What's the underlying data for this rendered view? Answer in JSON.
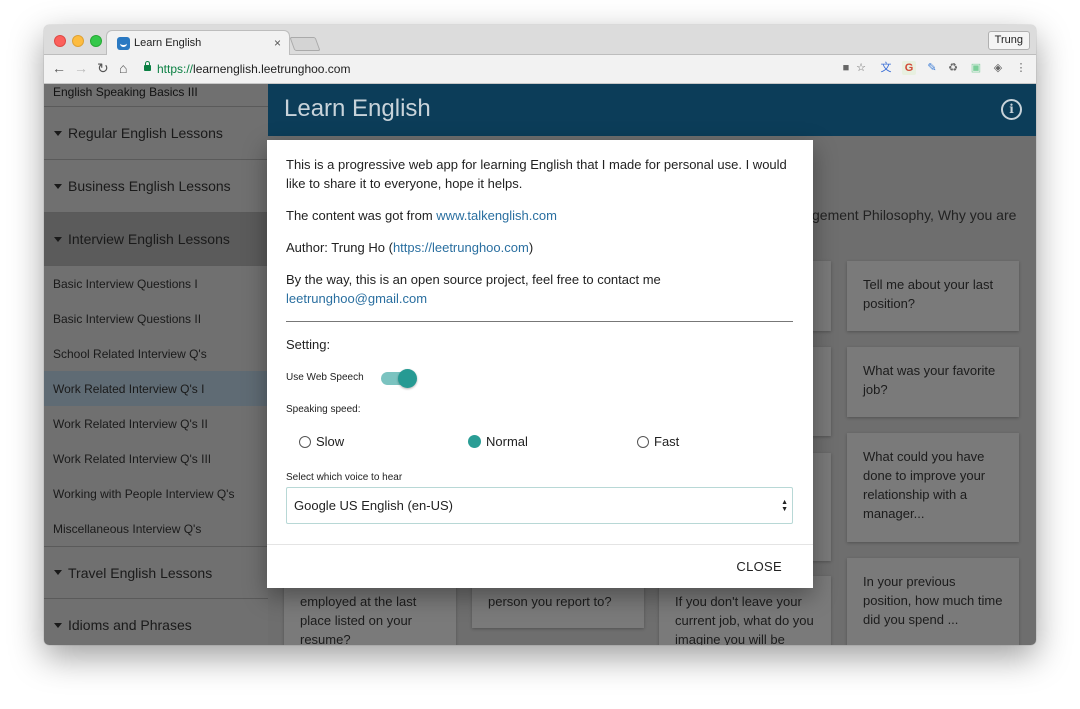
{
  "browser": {
    "tab_title": "Learn English",
    "tab_close": "×",
    "profile_name": "Trung",
    "url_scheme": "https://",
    "url_rest": "learnenglish.leetrunghoo.com",
    "nav": {
      "back": "←",
      "forward": "→",
      "reload": "↻",
      "home": "⌂"
    },
    "toolbar_icons": [
      "camera-icon",
      "star-icon",
      "translate-extension-icon",
      "google-extension-icon",
      "pen-extension-icon",
      "recycle-extension-icon",
      "extension-icon",
      "shield-extension-icon",
      "more-menu-icon"
    ],
    "toolbar_glyphs": [
      "■",
      "☆",
      "文",
      "G",
      "✎",
      "♻",
      "▣",
      "◈",
      "⋮"
    ]
  },
  "sidebar": {
    "top_item": "English Speaking Basics III",
    "sections_before": [
      {
        "label": "Regular English Lessons"
      },
      {
        "label": "Business English Lessons"
      }
    ],
    "open_section": {
      "label": "Interview English Lessons"
    },
    "items": [
      {
        "label": "Basic Interview Questions I"
      },
      {
        "label": "Basic Interview Questions II"
      },
      {
        "label": "School Related Interview Q's"
      },
      {
        "label": "Work Related Interview Q's I",
        "active": true
      },
      {
        "label": "Work Related Interview Q's II"
      },
      {
        "label": "Work Related Interview Q's III"
      },
      {
        "label": "Working with People Interview Q's"
      },
      {
        "label": "Miscellaneous Interview Q's"
      }
    ],
    "sections_after": [
      {
        "label": "Travel English Lessons"
      },
      {
        "label": "Idioms and Phrases"
      }
    ]
  },
  "app": {
    "title": "Learn English",
    "info_icon": "i",
    "background_text": "gement Philosophy, Why you are",
    "cards": [
      {
        "text": "Tell me about your last position?"
      },
      {
        "text": "What was your favorite job?"
      },
      {
        "text": "What could you have done to improve your relationship with a manager..."
      },
      {
        "text": "In your previous position, how much time did you spend ..."
      },
      {
        "text": "employed at the last place listed on your resume?"
      },
      {
        "text": "person you report to?"
      },
      {
        "text": "If you don't leave your current job, what do you imagine you will be"
      }
    ]
  },
  "dialog": {
    "intro": "This is a progressive web app for learning English that I made for personal use. I would like to share it to everyone, hope it helps.",
    "content_prefix": "The content was got from ",
    "content_link": "www.talkenglish.com",
    "author_prefix": "Author: Trung Ho (",
    "author_link": "https://leetrunghoo.com",
    "author_suffix": ")",
    "contact_text": "By the way, this is an open source project, feel free to contact me",
    "contact_email": "leetrunghoo@gmail.com",
    "setting_label": "Setting:",
    "web_speech_label": "Use Web Speech",
    "web_speech_enabled": true,
    "speed_label": "Speaking speed:",
    "speed_options": [
      "Slow",
      "Normal",
      "Fast"
    ],
    "speed_selected": "Normal",
    "voice_label": "Select which voice to hear",
    "voice_selected": "Google US English (en-US)",
    "close_label": "CLOSE"
  },
  "colors": {
    "appbar": "#0c3d59",
    "accent": "#2a9d95",
    "link": "#2a6fa0"
  }
}
